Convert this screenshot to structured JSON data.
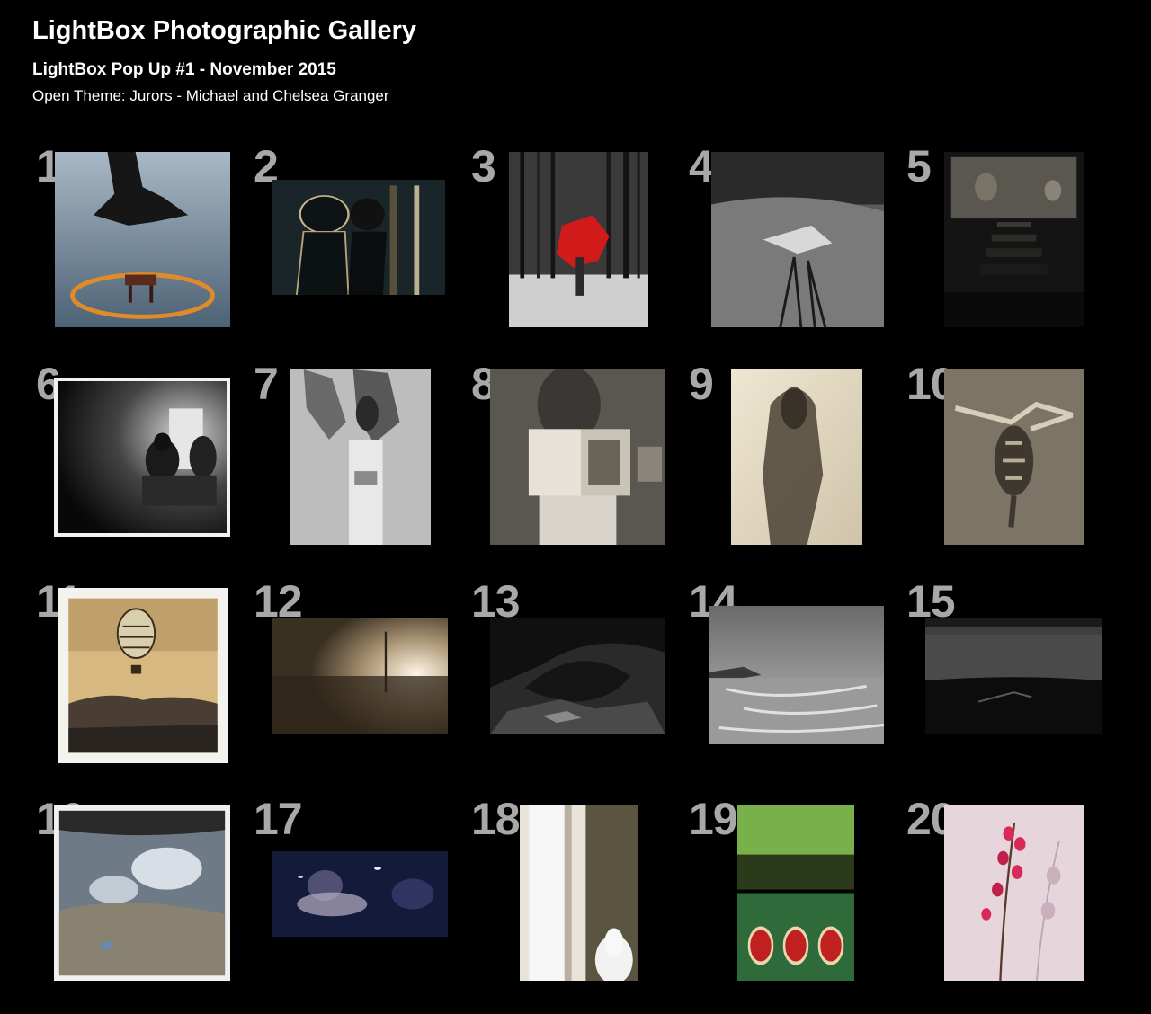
{
  "gallery": {
    "title": "LightBox Photographic Gallery",
    "subtitle": "LightBox Pop Up #1 - November 2015",
    "theme": "Open Theme: Jurors - Michael and Chelsea Granger"
  },
  "photos": [
    {
      "number": "1",
      "palette": "blue-sea-fire"
    },
    {
      "number": "2",
      "palette": "dark-green-negative"
    },
    {
      "number": "3",
      "palette": "snow-forest-red"
    },
    {
      "number": "4",
      "palette": "grey-grass"
    },
    {
      "number": "5",
      "palette": "tintype-steps"
    },
    {
      "number": "6",
      "palette": "dark-room-figures"
    },
    {
      "number": "7",
      "palette": "bw-hands"
    },
    {
      "number": "8",
      "palette": "sepia-book"
    },
    {
      "number": "9",
      "palette": "cream-blurred-figure"
    },
    {
      "number": "10",
      "palette": "sepia-turtle"
    },
    {
      "number": "11",
      "palette": "balloon-polaroid"
    },
    {
      "number": "12",
      "palette": "sepia-field-sun"
    },
    {
      "number": "13",
      "palette": "dark-rock-cave"
    },
    {
      "number": "14",
      "palette": "bw-tidal-beach"
    },
    {
      "number": "15",
      "palette": "dark-lake"
    },
    {
      "number": "16",
      "palette": "sky-reflection"
    },
    {
      "number": "17",
      "palette": "blue-night-blur"
    },
    {
      "number": "18",
      "palette": "window-cat"
    },
    {
      "number": "19",
      "palette": "green-car-diptych"
    },
    {
      "number": "20",
      "palette": "pink-flowers"
    }
  ]
}
